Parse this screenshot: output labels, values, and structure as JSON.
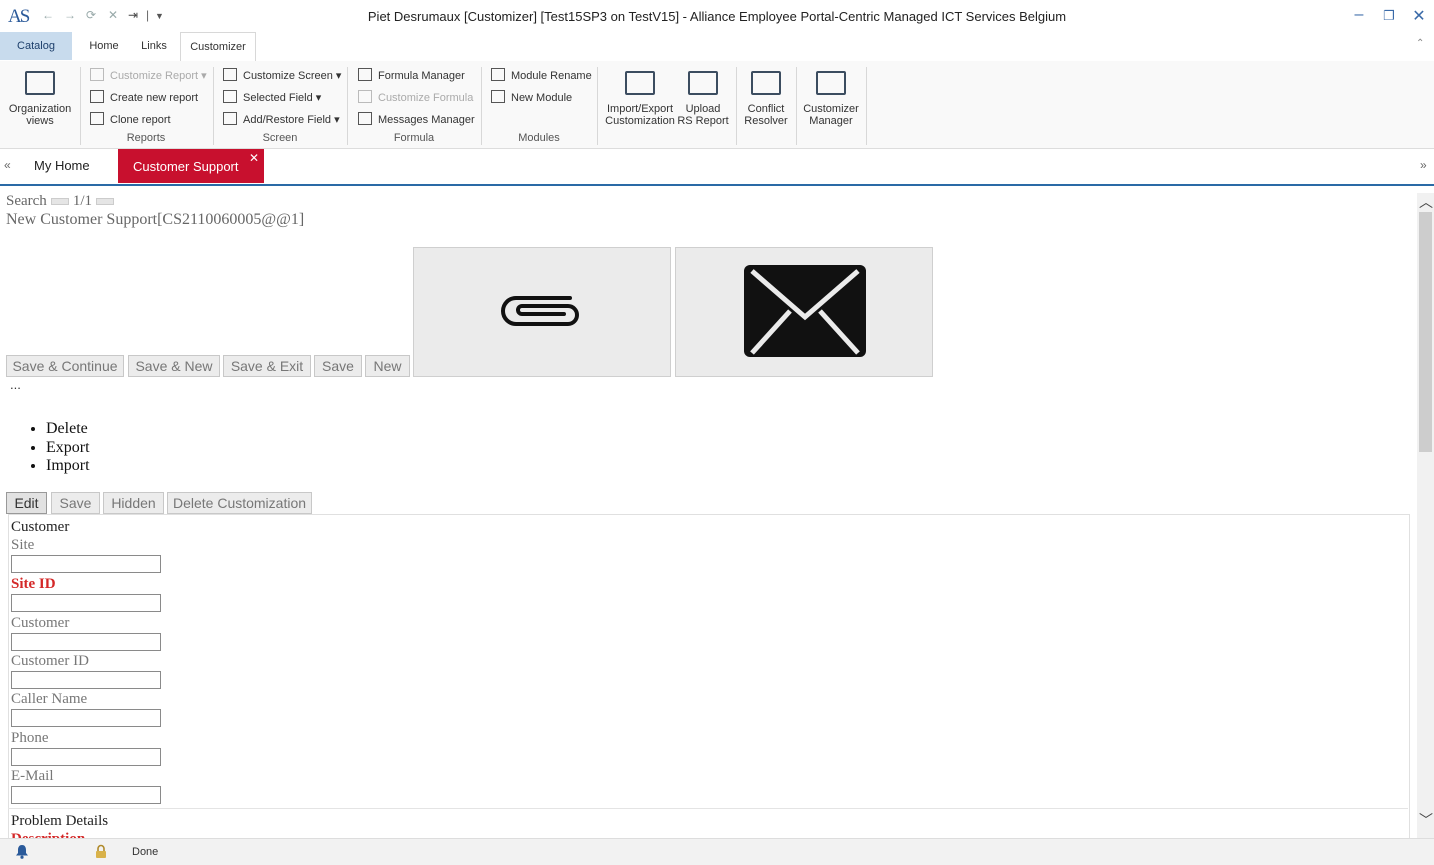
{
  "titlebar": {
    "logo": "AS",
    "window_title": "Piet Desrumaux [Customizer]  [Test15SP3 on TestV15] - Alliance Employee Portal-Centric Managed ICT Services Belgium",
    "quick_access": [
      "back-icon",
      "forward-icon",
      "refresh-icon",
      "stop-icon",
      "exit-icon",
      "customize-qat-icon"
    ],
    "window_controls": [
      "minimize-icon",
      "restore-icon",
      "close-icon"
    ]
  },
  "ribbon_tabs": {
    "catalog": "Catalog",
    "home": "Home",
    "links": "Links",
    "customizer": "Customizer",
    "active": "Customizer"
  },
  "ribbon": {
    "org_views": {
      "line1": "Organization",
      "line2": "views"
    },
    "reports": {
      "customize_report": "Customize Report",
      "create_new_report": "Create new report",
      "clone_report": "Clone report",
      "label": "Reports"
    },
    "screen": {
      "customize_screen": "Customize Screen",
      "selected_field": "Selected Field",
      "add_restore_field": "Add/Restore Field",
      "label": "Screen"
    },
    "formula": {
      "formula_manager": "Formula Manager",
      "customize_formula": "Customize Formula",
      "messages_manager": "Messages Manager",
      "label": "Formula"
    },
    "modules": {
      "module_rename": "Module Rename",
      "new_module": "New Module",
      "label": "Modules"
    },
    "import_export": {
      "line1": "Import/Export",
      "line2": "Customization"
    },
    "upload_rs": {
      "line1": "Upload",
      "line2": "RS Report"
    },
    "conflict": {
      "line1": "Conflict",
      "line2": "Resolver"
    },
    "cust_manager": {
      "line1": "Customizer",
      "line2": "Manager"
    }
  },
  "doc_tabs": {
    "collapse_left": "«",
    "expand_right": "»",
    "my_home": "My Home",
    "customer_support": "Customer Support",
    "close_glyph": "✕"
  },
  "content": {
    "search_label": "Search",
    "pager": "1/1",
    "record_title": "New Customer Support[CS2110060005@@1]",
    "tiles": [
      "paperclip-icon",
      "envelope-icon"
    ],
    "actions": {
      "save_continue": "Save & Continue",
      "save_new": "Save & New",
      "save_exit": "Save & Exit",
      "save": "Save",
      "new": "New"
    },
    "more": "...",
    "menu": [
      "Delete",
      "Export",
      "Import"
    ],
    "customize_buttons": {
      "edit": "Edit",
      "save": "Save",
      "hidden": "Hidden",
      "delete_customization": "Delete Customization"
    }
  },
  "form": {
    "section_customer": "Customer",
    "fields": [
      {
        "label": "Site",
        "required": false,
        "value": ""
      },
      {
        "label": "Site ID",
        "required": true,
        "value": ""
      },
      {
        "label": "Customer",
        "required": false,
        "value": ""
      },
      {
        "label": "Customer ID",
        "required": false,
        "value": ""
      },
      {
        "label": "Caller Name",
        "required": false,
        "value": ""
      },
      {
        "label": "Phone",
        "required": false,
        "value": ""
      },
      {
        "label": "E-Mail",
        "required": false,
        "value": ""
      }
    ],
    "section_problem": "Problem Details",
    "next_field": "Description"
  },
  "status": {
    "text": "Done"
  },
  "colors": {
    "accent_red": "#c8102e",
    "ribbon_tab_selected": "#c8dbed",
    "tab_underline": "#2a6aa6",
    "required_label": "#d42828"
  }
}
